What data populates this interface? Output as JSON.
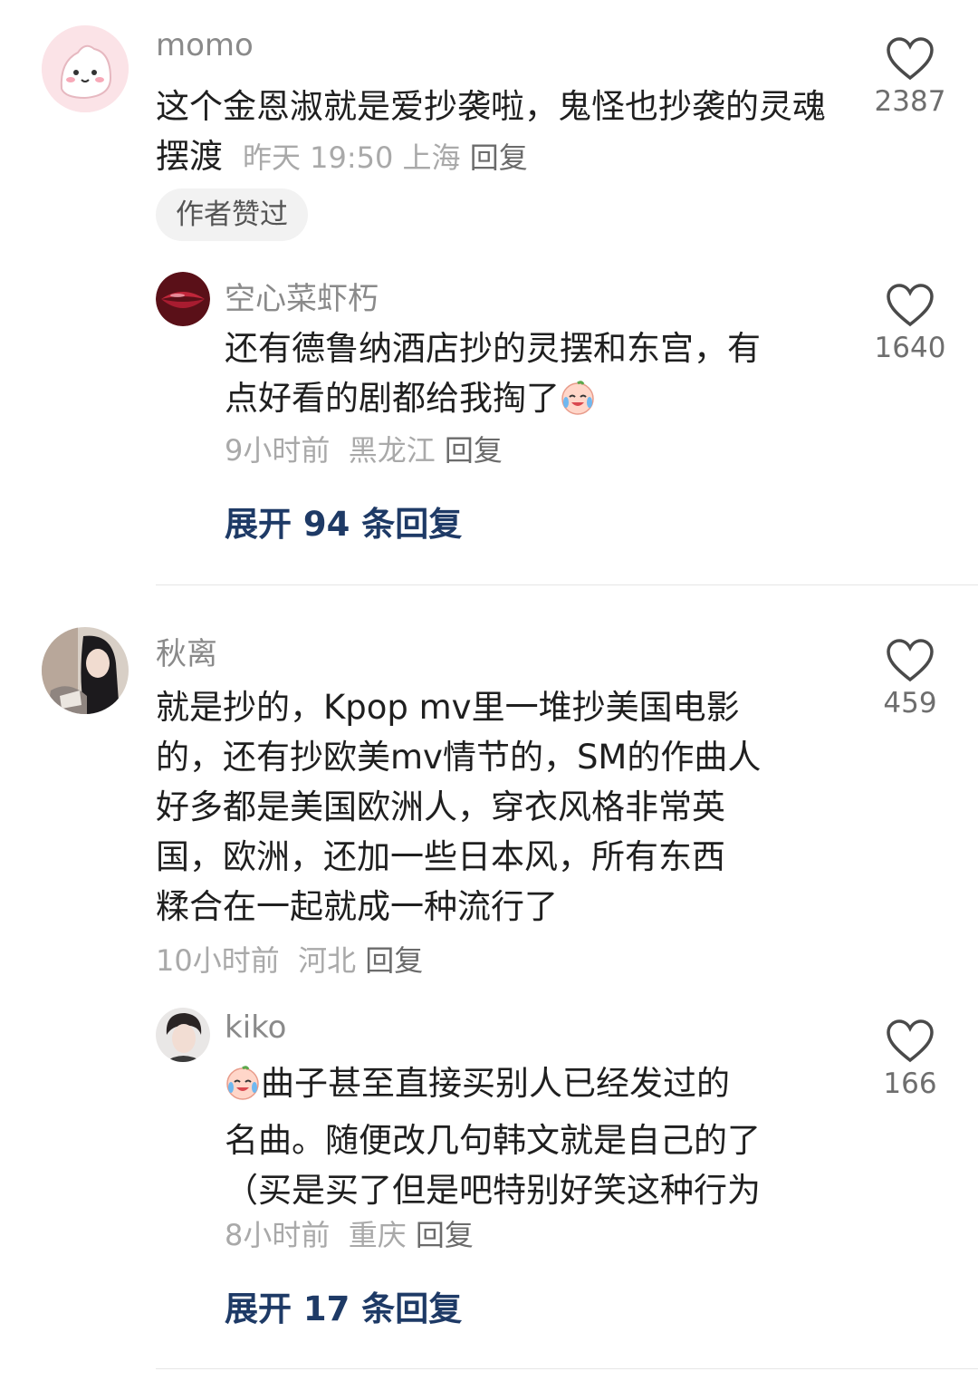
{
  "comments": [
    {
      "username": "momo",
      "text": "这个金恩淑就是爱抄袭啦，鬼怪也抄袭的灵魂摆渡",
      "time": "昨天 19:50",
      "location": "上海",
      "reply_label": "回复",
      "likes": "2387",
      "badge": "作者赞过",
      "reply": {
        "username": "空心菜虾朽",
        "text_line1": "还有德鲁纳酒店抄的灵摆和东宫，有",
        "text_line2": "点好看的剧都给我掏了",
        "time": "9小时前",
        "location": "黑龙江",
        "reply_label": "回复",
        "likes": "1640"
      },
      "expand_label": "展开 94 条回复"
    },
    {
      "username": "秋离",
      "lines": [
        "就是抄的，Kpop mv里一堆抄美国电影",
        "的，还有抄欧美mv情节的，SM的作曲人",
        "好多都是美国欧洲人，穿衣风格非常英",
        "国，欧洲，还加一些日本风，所有东西",
        "糅合在一起就成一种流行了"
      ],
      "time": "10小时前",
      "location": "河北",
      "reply_label": "回复",
      "likes": "459",
      "reply": {
        "username": "kiko",
        "text_line1": "曲子甚至直接买别人已经发过的",
        "text_line2": "名曲。随便改几句韩文就是自己的了",
        "text_line3": "（买是买了但是吧特别好笑这种行为",
        "time": "8小时前",
        "location": "重庆",
        "reply_label": "回复",
        "likes": "166"
      },
      "expand_label": "展开 17 条回复"
    }
  ],
  "icons": {
    "like": "heart-outline-icon",
    "emoji": "crying-laughing-emoji-icon"
  },
  "colors": {
    "expand_link": "#1e3a66",
    "meta": "#a9a9a9",
    "username": "#8a8a8a"
  }
}
